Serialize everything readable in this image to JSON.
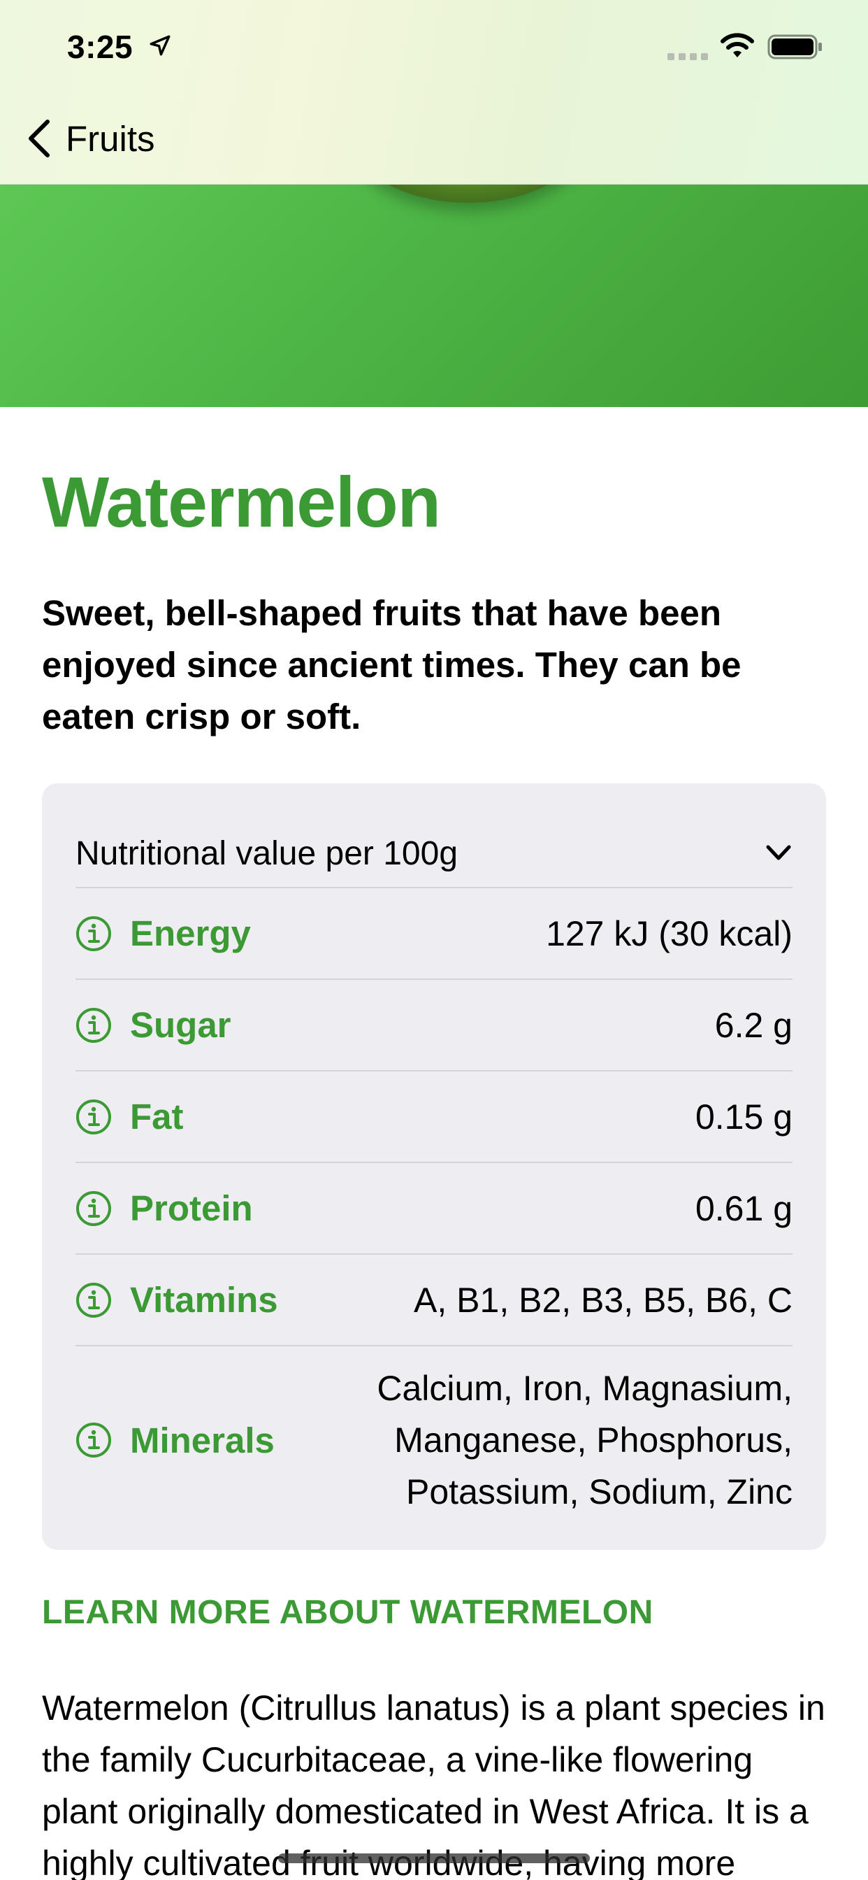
{
  "status_bar": {
    "time": "3:25"
  },
  "nav": {
    "back_label": "Fruits"
  },
  "fruit": {
    "title": "Watermelon",
    "headline": "Sweet, bell-shaped fruits that have been enjoyed since ancient times. They can be eaten crisp or soft."
  },
  "nutrition": {
    "header": "Nutritional value per 100g",
    "rows": [
      {
        "label": "Energy",
        "value": "127 kJ (30 kcal)"
      },
      {
        "label": "Sugar",
        "value": "6.2 g"
      },
      {
        "label": "Fat",
        "value": "0.15 g"
      },
      {
        "label": "Protein",
        "value": "0.61 g"
      },
      {
        "label": "Vitamins",
        "value": "A, B1, B2, B3, B5, B6, C"
      },
      {
        "label": "Minerals",
        "value": "Calcium, Iron, Magnasium, Manganese, Phosphorus, Potassium, Sodium, Zinc",
        "lines": [
          "Calcium, Iron, Magnasium,",
          "Manganese, Phosphorus,",
          "Potassium, Sodium, Zinc"
        ]
      }
    ]
  },
  "learn_more": {
    "label": "LEARN MORE ABOUT WATERMELON",
    "body": "Watermelon (Citrullus lanatus) is a plant species in the family Cucurbitaceae, a vine-like flowering plant originally domesticated in West Africa. It is a highly cultivated fruit worldwide, having more"
  },
  "colors": {
    "accent": "#3c9a35",
    "hero_green": "#4fb847",
    "card_bg": "#eeedf2"
  },
  "icons": {
    "back": "chevron-left-icon",
    "expand": "chevron-down-icon",
    "info": "info-circle-icon",
    "location": "location-arrow-icon",
    "wifi": "wifi-icon",
    "battery": "battery-icon",
    "signal": "signal-icon"
  }
}
